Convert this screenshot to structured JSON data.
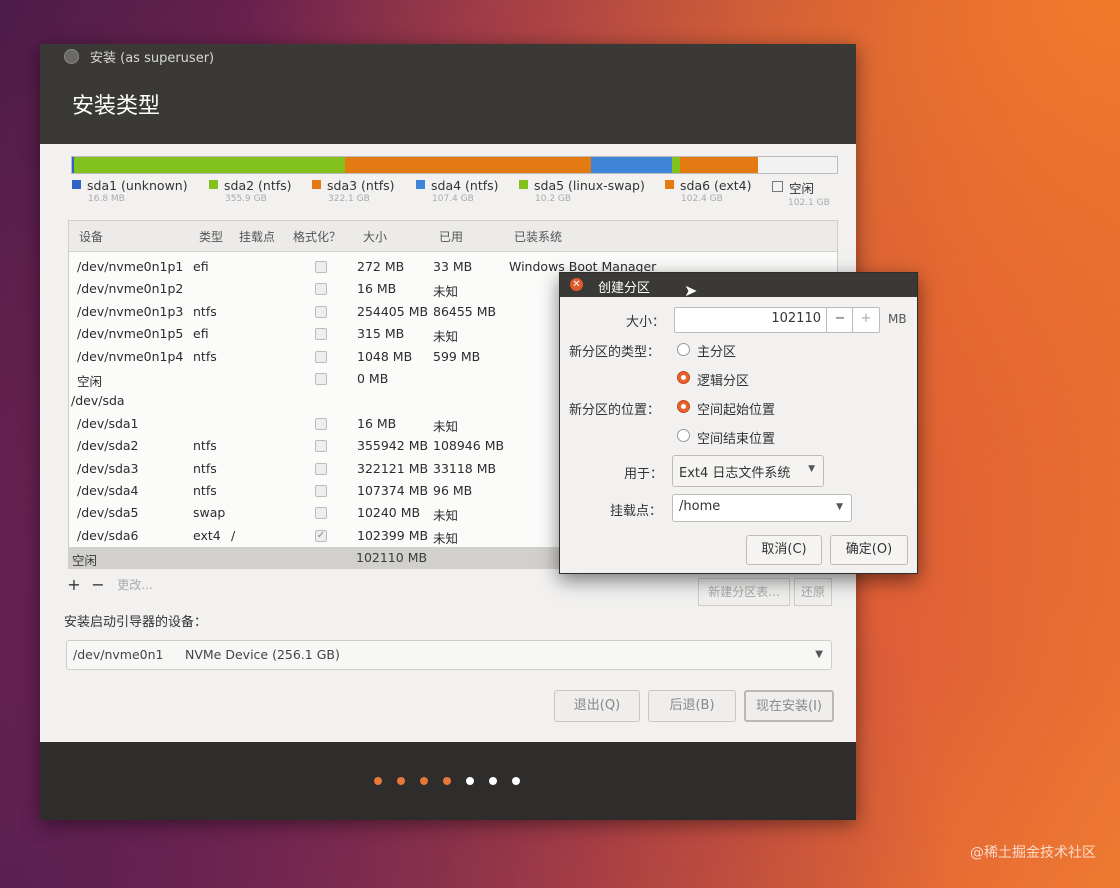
{
  "window": {
    "title": "安装 (as superuser)",
    "heading": "安装类型"
  },
  "usage_bar": [
    {
      "name": "sda1 (unknown)",
      "size": "16.8 MB",
      "color": "#2e64c8",
      "pct": 0.2
    },
    {
      "name": "sda2 (ntfs)",
      "size": "355.9 GB",
      "color": "#82c11e",
      "pct": 35.5
    },
    {
      "name": "sda3 (ntfs)",
      "size": "322.1 GB",
      "color": "#e47b12",
      "pct": 32.2
    },
    {
      "name": "sda4 (ntfs)",
      "size": "107.4 GB",
      "color": "#3e85d8",
      "pct": 10.6
    },
    {
      "name": "sda5 (linux-swap)",
      "size": "10.2 GB",
      "color": "#82c11e",
      "pct": 1.0
    },
    {
      "name": "sda6 (ext4)",
      "size": "102.4 GB",
      "color": "#e47b12",
      "pct": 10.2
    },
    {
      "name": "空闲",
      "size": "102.1 GB",
      "color": "#f2f2f2",
      "pct": 10.3
    }
  ],
  "table": {
    "headers": [
      "设备",
      "类型",
      "挂载点",
      "格式化？",
      "大小",
      "已用",
      "已装系统"
    ],
    "rows": [
      {
        "device": "/dev/nvme0n1p1",
        "type": "efi",
        "mount": "",
        "format": false,
        "size": "272 MB",
        "used": "33 MB",
        "system": "Windows Boot Manager"
      },
      {
        "device": "/dev/nvme0n1p2",
        "type": "",
        "mount": "",
        "format": false,
        "size": "16 MB",
        "used": "未知",
        "system": ""
      },
      {
        "device": "/dev/nvme0n1p3",
        "type": "ntfs",
        "mount": "",
        "format": false,
        "size": "254405 MB",
        "used": "86455 MB",
        "system": ""
      },
      {
        "device": "/dev/nvme0n1p5",
        "type": "efi",
        "mount": "",
        "format": false,
        "size": "315 MB",
        "used": "未知",
        "system": ""
      },
      {
        "device": "/dev/nvme0n1p4",
        "type": "ntfs",
        "mount": "",
        "format": false,
        "size": "1048 MB",
        "used": "599 MB",
        "system": ""
      },
      {
        "device": "空闲",
        "type": "",
        "mount": "",
        "format": false,
        "size": "0 MB",
        "used": "",
        "system": ""
      },
      {
        "device": "/dev/sda",
        "type": "",
        "mount": "",
        "format": null,
        "size": "",
        "used": "",
        "system": ""
      },
      {
        "device": "/dev/sda1",
        "type": "",
        "mount": "",
        "format": false,
        "size": "16 MB",
        "used": "未知",
        "system": ""
      },
      {
        "device": "/dev/sda2",
        "type": "ntfs",
        "mount": "",
        "format": false,
        "size": "355942 MB",
        "used": "108946 MB",
        "system": ""
      },
      {
        "device": "/dev/sda3",
        "type": "ntfs",
        "mount": "",
        "format": false,
        "size": "322121 MB",
        "used": "33118 MB",
        "system": ""
      },
      {
        "device": "/dev/sda4",
        "type": "ntfs",
        "mount": "",
        "format": false,
        "size": "107374 MB",
        "used": "96 MB",
        "system": ""
      },
      {
        "device": "/dev/sda5",
        "type": "swap",
        "mount": "",
        "format": false,
        "size": "10240 MB",
        "used": "未知",
        "system": ""
      },
      {
        "device": "/dev/sda6",
        "type": "ext4",
        "mount": "/",
        "format": true,
        "size": "102399 MB",
        "used": "未知",
        "system": ""
      }
    ],
    "free_row": {
      "device": "空闲",
      "size": "102110 MB"
    }
  },
  "controls": {
    "add": "+",
    "remove": "−",
    "change": "更改...",
    "new_table": "新建分区表...",
    "revert": "还原"
  },
  "boot": {
    "label": "安装启动引导器的设备：",
    "device": "/dev/nvme0n1",
    "description": "NVMe Device (256.1 GB)"
  },
  "nav": {
    "quit": "退出(Q)",
    "back": "后退(B)",
    "install": "现在安装(I)"
  },
  "progress_dots": [
    {
      "color": "#e9763a"
    },
    {
      "color": "#e9763a"
    },
    {
      "color": "#e9763a"
    },
    {
      "color": "#e9763a"
    },
    {
      "color": "#ffffff"
    },
    {
      "color": "#ffffff"
    },
    {
      "color": "#ffffff"
    }
  ],
  "dialog": {
    "title": "创建分区",
    "size_label": "大小：",
    "size_value": "102110",
    "minus": "−",
    "plus": "+",
    "unit": "MB",
    "type_label": "新分区的类型：",
    "type_primary": "主分区",
    "type_logical": "逻辑分区",
    "type_selected": "logical",
    "location_label": "新分区的位置：",
    "loc_start": "空间起始位置",
    "loc_end": "空间结束位置",
    "location_selected": "start",
    "use_label": "用于：",
    "use_value": "Ext4 日志文件系统",
    "mount_label": "挂载点：",
    "mount_value": "/home",
    "cancel": "取消(C)",
    "ok": "确定(O)"
  },
  "watermark": "@稀土掘金技术社区"
}
